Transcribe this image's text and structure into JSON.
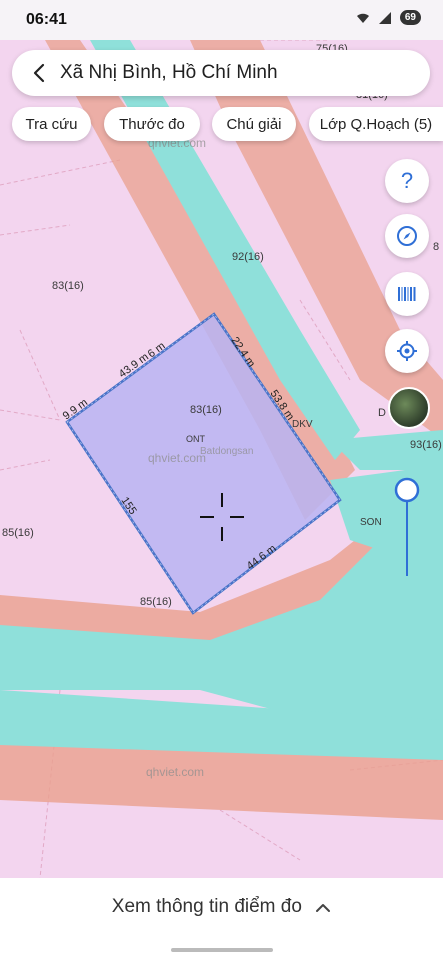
{
  "status": {
    "time": "06:41",
    "battery": "69"
  },
  "search": {
    "title": "Xã Nhị Bình, Hồ Chí Minh"
  },
  "chips": [
    {
      "label": "Tra cứu"
    },
    {
      "label": "Thước đo"
    },
    {
      "label": "Chú giải"
    },
    {
      "label": "Lớp Q.Hoạch (5)"
    }
  ],
  "fabs": {
    "help_label": "?"
  },
  "map": {
    "watermark_top": "qhviet.com",
    "watermark_mid": "qhviet.com",
    "watermark_bottom": "qhviet.com",
    "logo_text": "Batdongsan",
    "parcels": {
      "p75": "75(16)",
      "p81": "81(16)",
      "p92": "92(16)",
      "p83_left": "83(16)",
      "p83_center": "83(16)",
      "p85_left": "85(16)",
      "p85_bottom": "85(16)",
      "p93": "93(16)",
      "p8x": "8",
      "d_label": "D"
    },
    "landuse": {
      "ont": "ONT",
      "dkv": "DKV",
      "son": "SON"
    },
    "measurements": {
      "top_left_edge": "43.9 m",
      "top_left_edge_2": "6 m",
      "left_short": "9.9 m",
      "top_right_edge": "22.4 m",
      "right_edge": "53.8 m",
      "bottom_edge": "44.6 m",
      "left_edge": "155"
    }
  },
  "bottom_sheet": {
    "label": "Xem thông tin điểm đo"
  }
}
